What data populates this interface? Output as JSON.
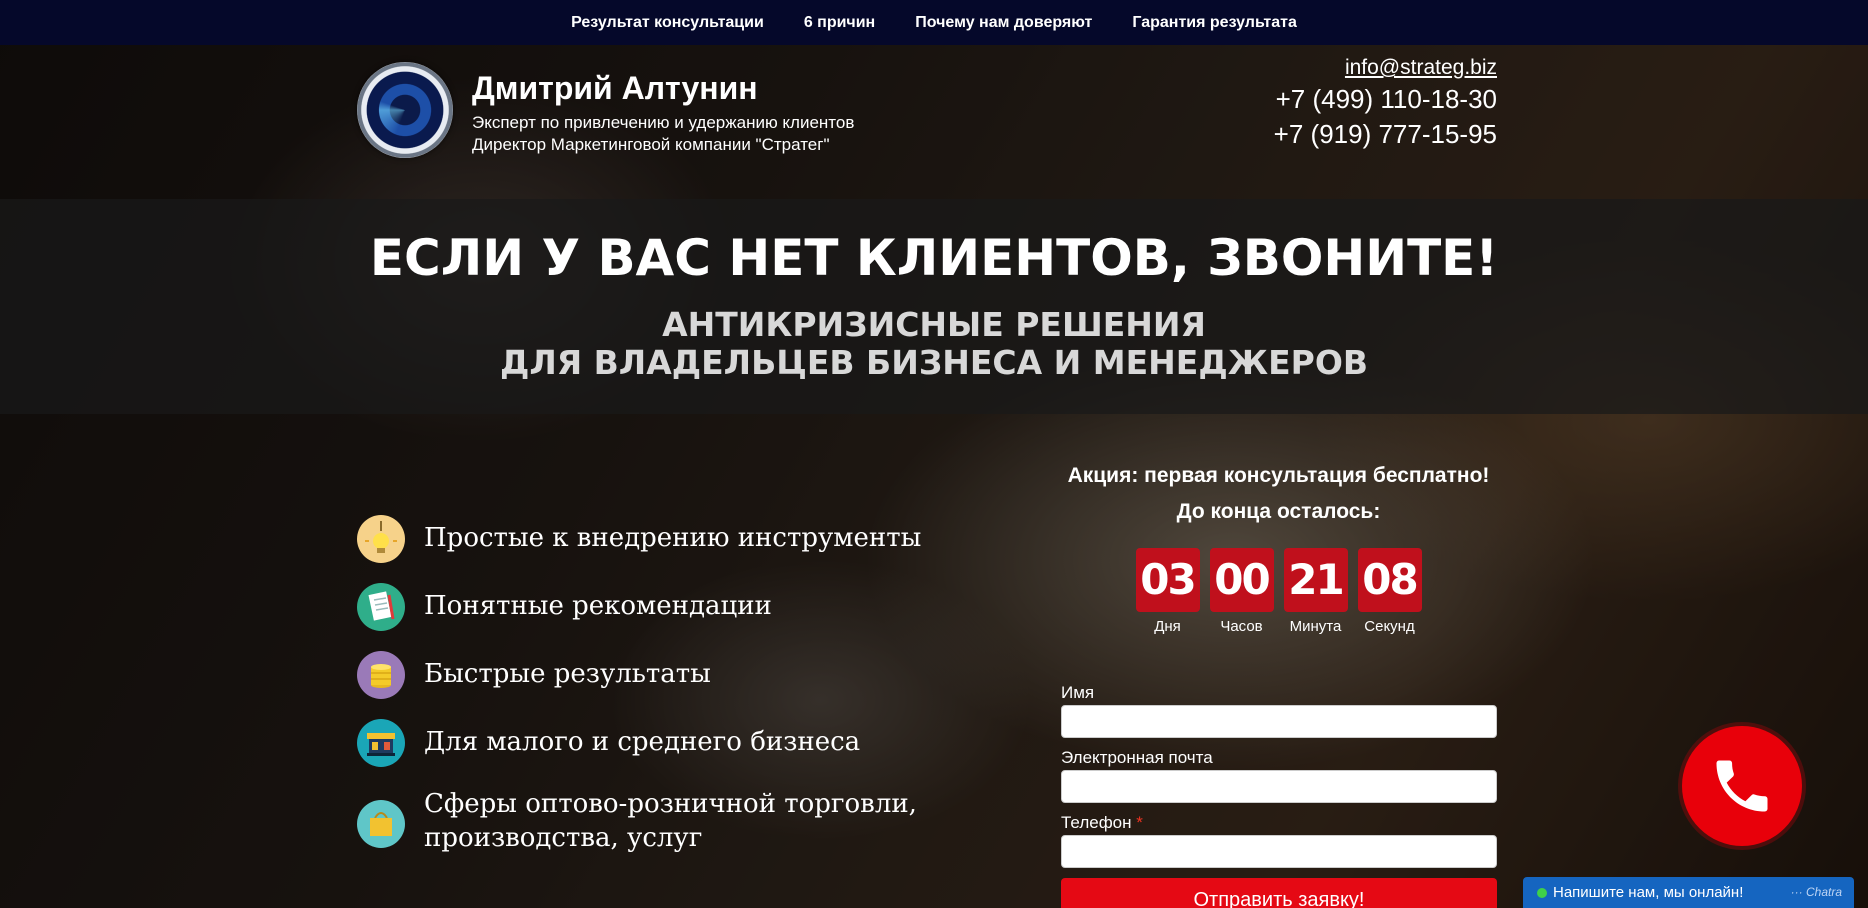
{
  "nav": {
    "items": [
      {
        "label": "Результат консультации"
      },
      {
        "label": "6 причин"
      },
      {
        "label": "Почему нам доверяют"
      },
      {
        "label": "Гарантия результата"
      }
    ]
  },
  "header": {
    "name": "Дмитрий Алтунин",
    "subtitle_line1": "Эксперт по привлечению и удержанию клиентов",
    "subtitle_line2": "Директор Маркетинговой компании \"Стратег\"",
    "email": "info@strateg.biz",
    "phone1": "+7 (499) 110-18-30",
    "phone2": "+7 (919) 777-15-95"
  },
  "hero": {
    "title": "ЕСЛИ У ВАС НЕТ КЛИЕНТОВ, ЗВОНИТЕ!",
    "subtitle_line1": "АНТИКРИЗИСНЫЕ РЕШЕНИЯ",
    "subtitle_line2": "ДЛЯ ВЛАДЕЛЬЦЕВ БИЗНЕСА И МЕНЕДЖЕРОВ"
  },
  "benefits": [
    {
      "text": "Простые к внедрению инструменты",
      "icon": "lightbulb-icon",
      "color": "#f6d28a"
    },
    {
      "text": "Понятные рекомендации",
      "icon": "document-icon",
      "color": "#2fae8a"
    },
    {
      "text": "Быстрые результаты",
      "icon": "coins-icon",
      "color": "#9a7ab8"
    },
    {
      "text": "Для малого и среднего бизнеса",
      "icon": "shop-icon",
      "color": "#1aa6b7"
    },
    {
      "text": "Сферы оптово-розничной торговли,\nпроизводства, услуг",
      "icon": "bag-icon",
      "color": "#5fc6c8"
    }
  ],
  "promo": {
    "title": "Акция: первая консультация бесплатно!",
    "countdown_label": "До конца осталось:",
    "timer": [
      {
        "value": "03",
        "label": "Дня"
      },
      {
        "value": "00",
        "label": "Часов"
      },
      {
        "value": "21",
        "label": "Минута"
      },
      {
        "value": "08",
        "label": "Секунд"
      }
    ]
  },
  "form": {
    "name_label": "Имя",
    "email_label": "Электронная почта",
    "phone_label": "Телефон",
    "required_mark": "*",
    "submit_label": "Отправить заявку!"
  },
  "chat": {
    "text": "Напишите нам, мы онлайн!",
    "brand": "··· Chatra"
  },
  "colors": {
    "nav_bg": "#05082a",
    "accent_red": "#e50914",
    "timer_red": "#c0101c",
    "chat_blue": "#1565c0"
  }
}
